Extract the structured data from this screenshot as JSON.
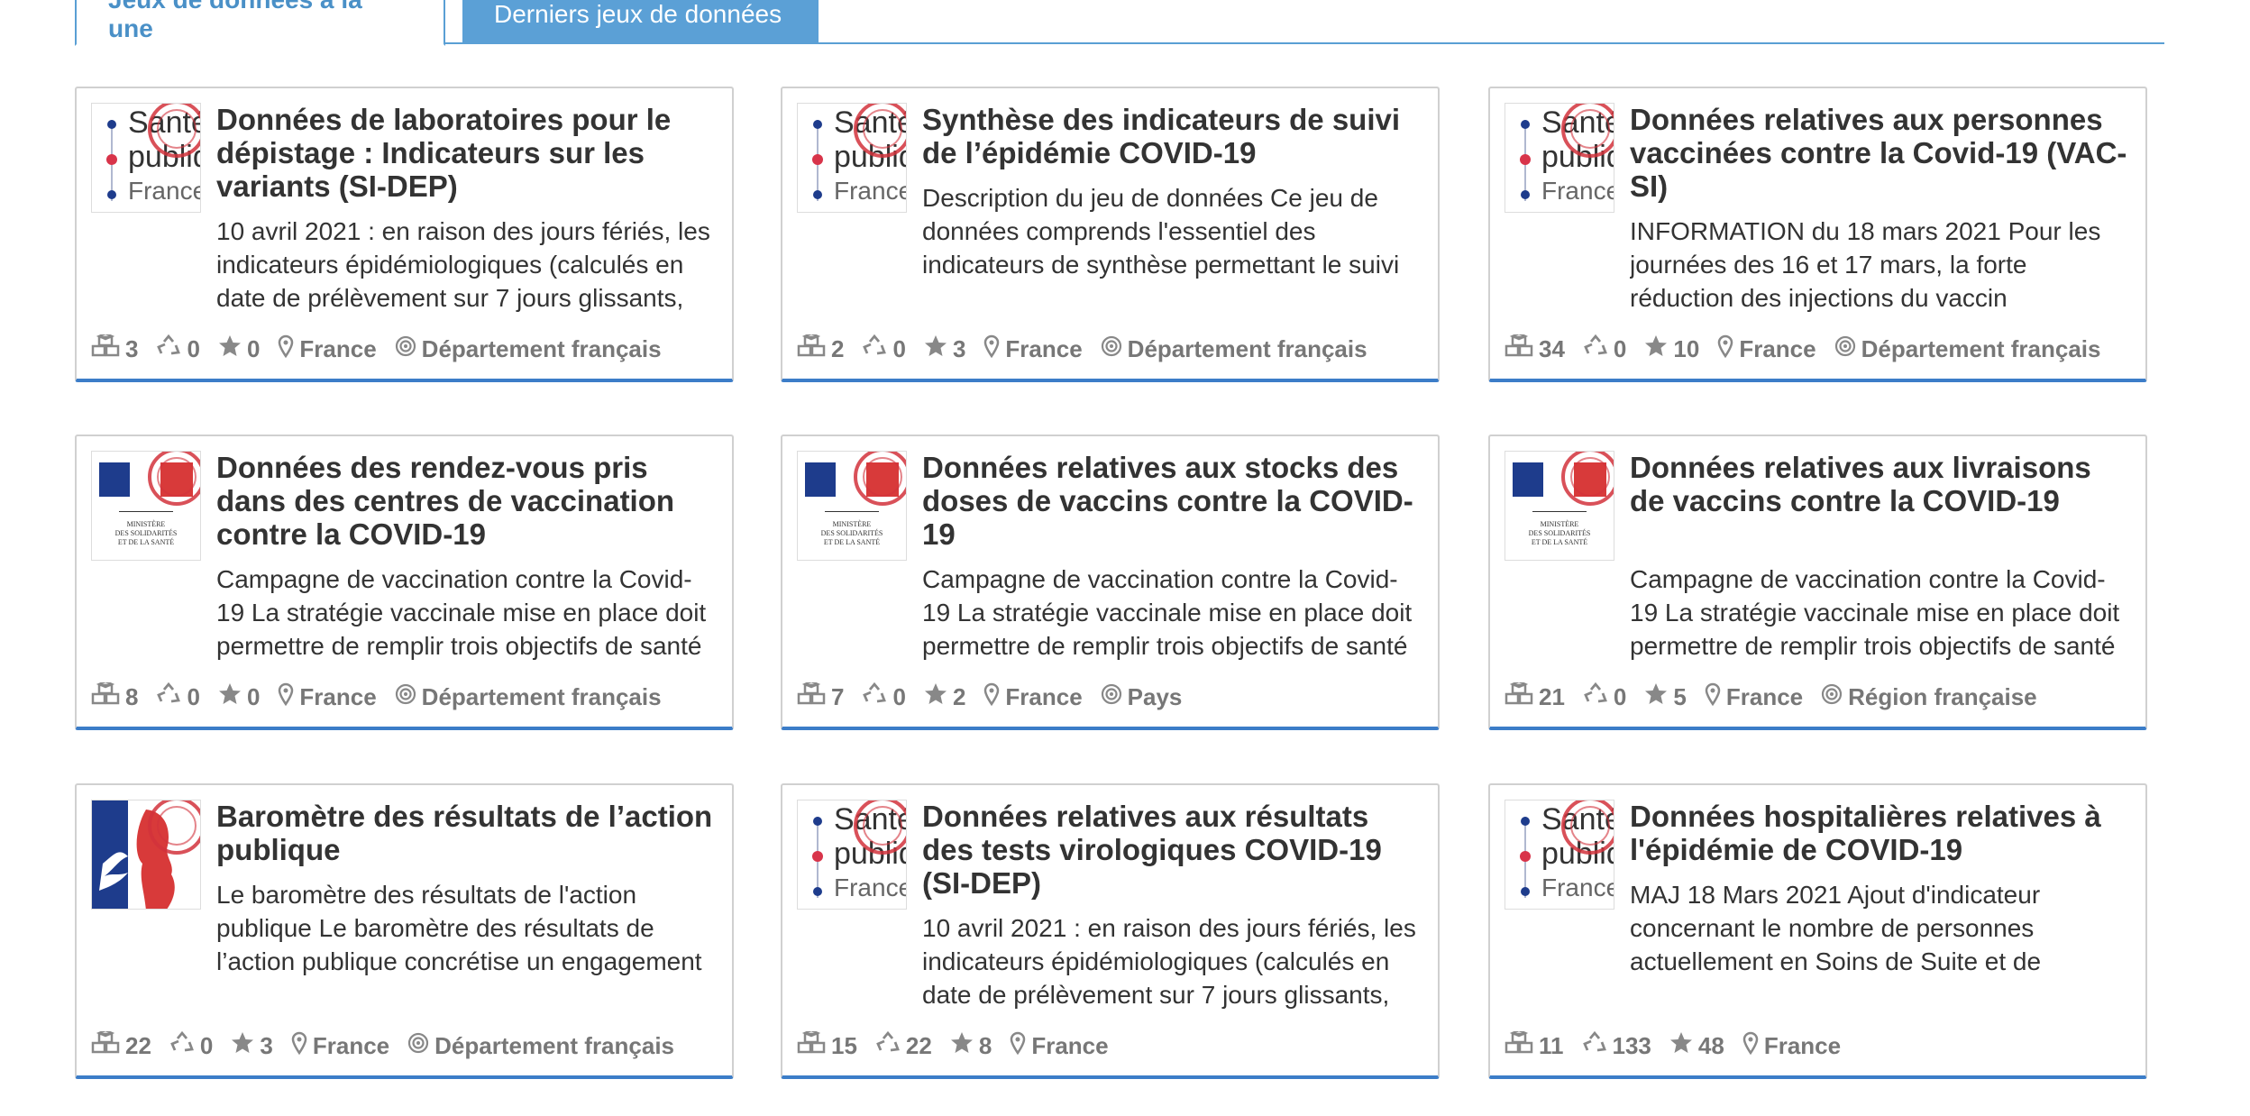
{
  "tabs": [
    {
      "label": "Jeux de données à la une",
      "active": true
    },
    {
      "label": "Derniers jeux de données",
      "active": false
    }
  ],
  "colors": {
    "accent": "#3c7dc8",
    "tab_bg": "#5ba0d6",
    "meta": "#777777"
  },
  "icons": {
    "reuses": "cubes-icon",
    "recycle": "recycle-icon",
    "followers": "star-icon",
    "place": "map-marker-icon",
    "granularity": "bullseye-icon"
  },
  "cards": [
    {
      "logo": "sante-publique-france",
      "logo_text": [
        "Santé",
        "publique",
        "France"
      ],
      "title": "Données de laboratoires pour le dépistage : Indicateurs sur les variants (SI-DEP)",
      "description": "10 avril 2021 : en raison des jours fériés, les indicateurs épidémiologiques (calculés en date de prélèvement sur 7 jours glissants,",
      "resources": "3",
      "reuses": "0",
      "followers": "0",
      "zone": "France",
      "granularity": "Département français"
    },
    {
      "logo": "sante-publique-france",
      "logo_text": [
        "Santé",
        "publique",
        "France"
      ],
      "title": "Synthèse des indicateurs de suivi de l’épidémie COVID-19",
      "description": "Description du jeu de données Ce jeu de données comprends l'essentiel des indicateurs de synthèse permettant le suivi",
      "resources": "2",
      "reuses": "0",
      "followers": "3",
      "zone": "France",
      "granularity": "Département français"
    },
    {
      "logo": "sante-publique-france",
      "logo_text": [
        "Santé",
        "publique",
        "France"
      ],
      "title": "Données relatives aux personnes vaccinées contre la Covid-19 (VAC-SI)",
      "description": "INFORMATION du 18 mars 2021 Pour les journées des 16 et 17 mars, la forte réduction des injections du vaccin",
      "resources": "34",
      "reuses": "0",
      "followers": "10",
      "zone": "France",
      "granularity": "Département français"
    },
    {
      "logo": "ministere-solidarites",
      "logo_text": [
        "MINISTÈRE",
        "DES SOLIDARITÉS",
        "ET DE LA SANTÉ"
      ],
      "title": "Données des rendez-vous pris dans des centres de vaccination contre la COVID-19",
      "description": "Campagne de vaccination contre la Covid-19 La stratégie vaccinale mise en place doit permettre de remplir trois objectifs de santé",
      "resources": "8",
      "reuses": "0",
      "followers": "0",
      "zone": "France",
      "granularity": "Département français"
    },
    {
      "logo": "ministere-solidarites",
      "logo_text": [
        "MINISTÈRE",
        "DES SOLIDARITÉS",
        "ET DE LA SANTÉ"
      ],
      "title": "Données relatives aux stocks des doses de vaccins contre la COVID-19",
      "description": "Campagne de vaccination contre la Covid-19 La stratégie vaccinale mise en place doit permettre de remplir trois objectifs de santé",
      "resources": "7",
      "reuses": "0",
      "followers": "2",
      "zone": "France",
      "granularity": "Pays"
    },
    {
      "logo": "ministere-solidarites",
      "logo_text": [
        "MINISTÈRE",
        "DES SOLIDARITÉS",
        "ET DE LA SANTÉ"
      ],
      "title": "Données relatives aux livraisons de vaccins contre la COVID-19",
      "description": "Campagne de vaccination contre la Covid-19 La stratégie vaccinale mise en place doit permettre de remplir trois objectifs de santé",
      "resources": "21",
      "reuses": "0",
      "followers": "5",
      "zone": "France",
      "granularity": "Région française"
    },
    {
      "logo": "marianne",
      "logo_text": [],
      "title": "Baromètre des résultats de l’action publique",
      "description": "Le baromètre des résultats de l'action publique Le baromètre des résultats de l’action publique concrétise un engagement",
      "resources": "22",
      "reuses": "0",
      "followers": "3",
      "zone": "France",
      "granularity": "Département français"
    },
    {
      "logo": "sante-publique-france",
      "logo_text": [
        "Santé",
        "publique",
        "France"
      ],
      "title": "Données relatives aux résultats des tests virologiques COVID-19 (SI-DEP)",
      "description": "10 avril 2021 : en raison des jours fériés, les indicateurs épidémiologiques (calculés en date de prélèvement sur 7 jours glissants,",
      "resources": "15",
      "reuses": "22",
      "followers": "8",
      "zone": "France",
      "granularity": ""
    },
    {
      "logo": "sante-publique-france",
      "logo_text": [
        "Santé",
        "publique",
        "France"
      ],
      "title": "Données hospitalières relatives à l'épidémie de COVID-19",
      "description": "MAJ 18 Mars 2021 Ajout d'indicateur concernant le nombre de personnes actuellement en Soins de Suite et de",
      "resources": "11",
      "reuses": "133",
      "followers": "48",
      "zone": "France",
      "granularity": ""
    }
  ]
}
